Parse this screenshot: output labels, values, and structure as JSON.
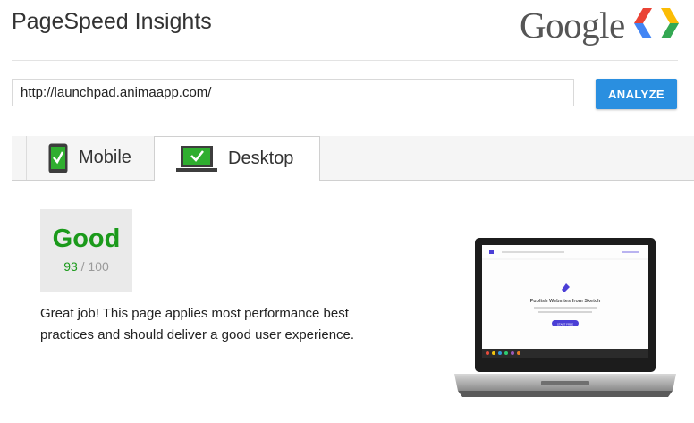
{
  "header": {
    "title": "PageSpeed Insights",
    "google_logo_text": "Google",
    "brand_colors": [
      "#4285F4",
      "#EA4335",
      "#FBBC05",
      "#34A853"
    ]
  },
  "url_form": {
    "url_value": "http://launchpad.animaapp.com/",
    "analyze_label": "ANALYZE",
    "button_color": "#2a8fe0"
  },
  "tabs": [
    {
      "label": "Mobile",
      "icon": "mobile-phone-check-icon",
      "active": false
    },
    {
      "label": "Desktop",
      "icon": "desktop-monitor-check-icon",
      "active": true
    }
  ],
  "result": {
    "rating": "Good",
    "score": "93",
    "score_max": "/ 100",
    "rating_color": "#1b9a1b",
    "summary": "Great job! This page applies most performance best practices and should deliver a good user experience."
  },
  "screenshot_preview": {
    "site_heading": "Publish Websites from Sketch",
    "cta_label": "START FREE"
  }
}
